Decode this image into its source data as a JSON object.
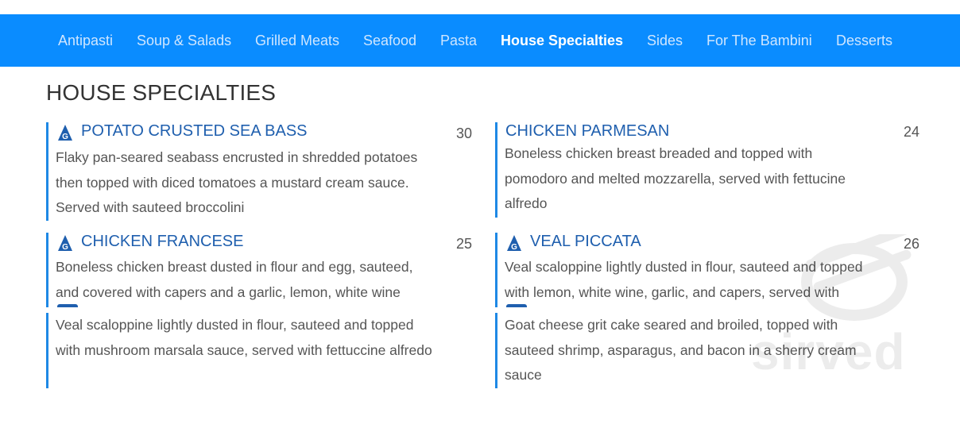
{
  "nav": {
    "items": [
      {
        "label": "Antipasti"
      },
      {
        "label": "Soup & Salads"
      },
      {
        "label": "Grilled Meats"
      },
      {
        "label": "Seafood"
      },
      {
        "label": "Pasta"
      },
      {
        "label": "House Specialties"
      },
      {
        "label": "Sides"
      },
      {
        "label": "For The Bambini"
      },
      {
        "label": "Desserts"
      }
    ],
    "active": "House Specialties",
    "background": "#0a8cff"
  },
  "section": {
    "title": "HOUSE SPECIALTIES"
  },
  "accent_color": "#1e88e5",
  "title_color": "#1f5fae",
  "items": [
    {
      "title": "POTATO CRUSTED SEA BASS",
      "price": "30",
      "gluten_free": true,
      "gluten_badge_letter": "G",
      "description": "Flaky pan-seared seabass encrusted in shredded potatoes then topped with diced tomatoes a mustard cream sauce. Served with sauteed broccolini"
    },
    {
      "title": "CHICKEN PARMESAN",
      "price": "24",
      "gluten_free": false,
      "description": "Boneless chicken breast breaded and topped with pomodoro and melted mozzarella, served with fettucine alfredo"
    },
    {
      "title": "CHICKEN FRANCESE",
      "price": "25",
      "gluten_free": true,
      "gluten_badge_letter": "G",
      "description": "Boneless chicken breast dusted in flour and egg, sauteed, and covered with capers and a garlic, lemon, white wine"
    },
    {
      "title": "VEAL PICCATA",
      "price": "26",
      "gluten_free": true,
      "gluten_badge_letter": "G",
      "description": "Veal scaloppine lightly dusted in flour, sauteed and topped with lemon, white wine, garlic, and capers, served with"
    },
    {
      "description": "Veal scaloppine lightly dusted in flour, sauteed and topped with mushroom marsala sauce, served with fettuccine alfredo"
    },
    {
      "description": "Goat cheese grit cake seared and broiled, topped with sauteed shrimp, asparagus, and bacon in a sherry cream sauce"
    }
  ],
  "watermark": {
    "text": "sirved",
    "icon": "fork-knife-plate-icon"
  }
}
